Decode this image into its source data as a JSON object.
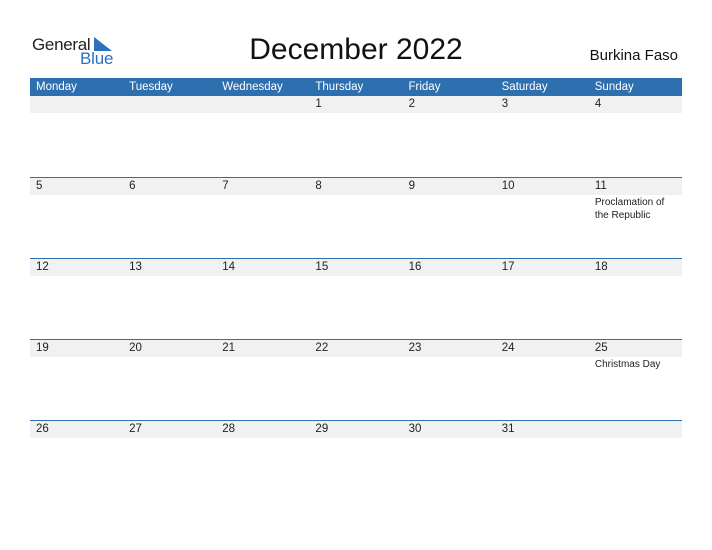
{
  "logo": {
    "part1": "General",
    "part2": "Blue"
  },
  "title": "December 2022",
  "country": "Burkina Faso",
  "colors": {
    "accent": "#2e6fb0",
    "strip": "#f1f1f1",
    "logo_blue": "#2a72c0"
  },
  "weekdays": [
    "Monday",
    "Tuesday",
    "Wednesday",
    "Thursday",
    "Friday",
    "Saturday",
    "Sunday"
  ],
  "weeks": [
    {
      "days": [
        {
          "num": ""
        },
        {
          "num": ""
        },
        {
          "num": ""
        },
        {
          "num": "1"
        },
        {
          "num": "2"
        },
        {
          "num": "3"
        },
        {
          "num": "4"
        }
      ]
    },
    {
      "days": [
        {
          "num": "5"
        },
        {
          "num": "6"
        },
        {
          "num": "7"
        },
        {
          "num": "8"
        },
        {
          "num": "9"
        },
        {
          "num": "10"
        },
        {
          "num": "11",
          "event": "Proclamation of the Republic"
        }
      ]
    },
    {
      "days": [
        {
          "num": "12"
        },
        {
          "num": "13"
        },
        {
          "num": "14"
        },
        {
          "num": "15"
        },
        {
          "num": "16"
        },
        {
          "num": "17"
        },
        {
          "num": "18"
        }
      ]
    },
    {
      "days": [
        {
          "num": "19"
        },
        {
          "num": "20"
        },
        {
          "num": "21"
        },
        {
          "num": "22"
        },
        {
          "num": "23"
        },
        {
          "num": "24"
        },
        {
          "num": "25",
          "event": "Christmas Day"
        }
      ]
    },
    {
      "days": [
        {
          "num": "26"
        },
        {
          "num": "27"
        },
        {
          "num": "28"
        },
        {
          "num": "29"
        },
        {
          "num": "30"
        },
        {
          "num": "31"
        },
        {
          "num": ""
        }
      ]
    }
  ]
}
